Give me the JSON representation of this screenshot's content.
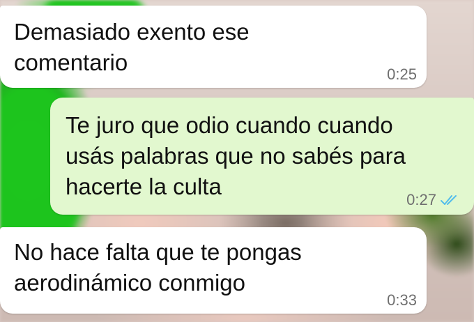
{
  "messages": [
    {
      "direction": "incoming",
      "text": "Demasiado exento ese\ncomentario",
      "time": "0:25"
    },
    {
      "direction": "outgoing",
      "text": "Te juro que odio cuando cuando\nusás palabras que no sabés para\nhacerte la culta",
      "time": "0:27",
      "status_icon": "double-check-read-icon",
      "status_color": "#53bdeb"
    },
    {
      "direction": "incoming",
      "text": "No hace falta que te pongas\naerodinámico conmigo",
      "time": "0:33"
    }
  ],
  "colors": {
    "incoming_bubble": "#ffffff",
    "outgoing_bubble": "#e2f8cf",
    "timestamp": "#6f6f6f"
  }
}
